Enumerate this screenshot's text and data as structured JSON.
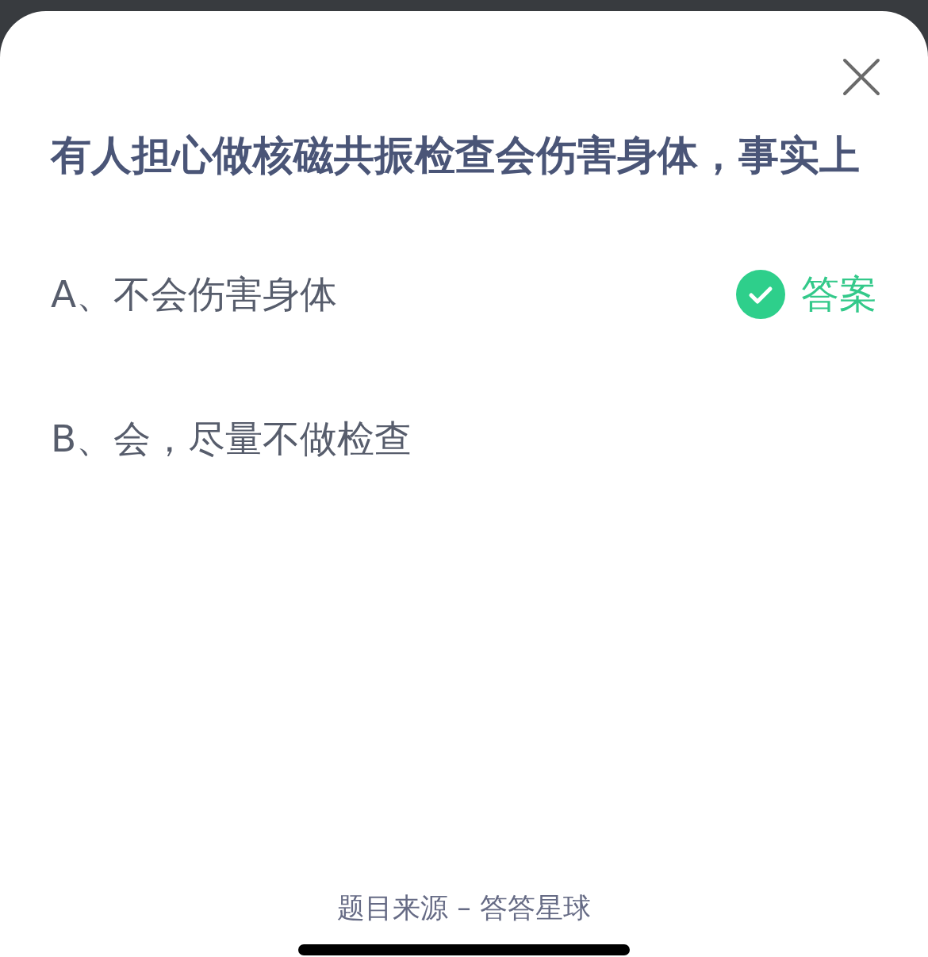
{
  "question": "有人担心做核磁共振检查会伤害身体，事实上",
  "answer_label": "答案",
  "options": [
    {
      "text": "A、不会伤害身体",
      "correct": true
    },
    {
      "text": "B、会，尽量不做检查",
      "correct": false
    }
  ],
  "footer": "题目来源 – 答答星球"
}
